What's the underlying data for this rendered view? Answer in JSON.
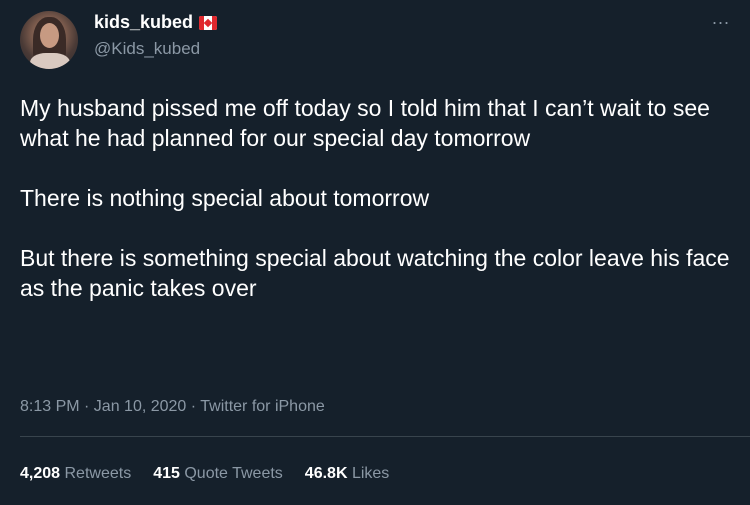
{
  "user": {
    "display_name": "kids_kubed",
    "handle": "@Kids_kubed",
    "flag_icon": "canada-flag-icon",
    "avatar_icon": "profile-photo"
  },
  "more_icon": "...",
  "tweet": {
    "paragraphs": [
      "My husband pissed me off today so I told him that I can’t wait to see what he had planned for our special day tomorrow",
      "There is nothing special about tomorrow",
      "But there is something special about watching the color leave his face as the panic takes over"
    ],
    "meta": "8:13 PM · Jan 10, 2020 · Twitter for iPhone"
  },
  "stats": {
    "retweets_count": "4,208",
    "retweets_label": "Retweets",
    "quotes_count": "415",
    "quotes_label": "Quote Tweets",
    "likes_count": "46.8K",
    "likes_label": "Likes"
  },
  "colors": {
    "background": "#15202b",
    "text_primary": "#ffffff",
    "text_secondary": "#8b98a5",
    "divider": "#38444d"
  }
}
